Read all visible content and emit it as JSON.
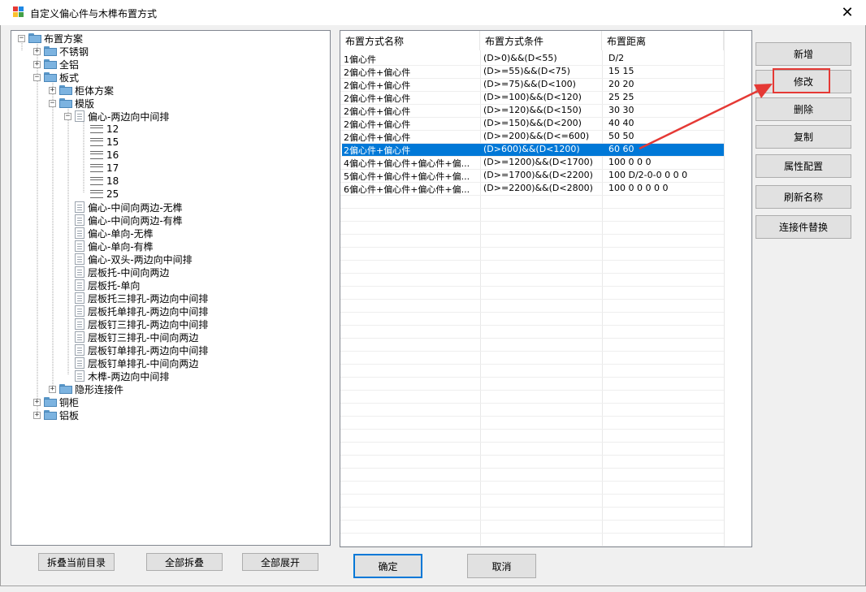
{
  "window": {
    "title": "自定义偏心件与木榫布置方式",
    "close_glyph": "✕"
  },
  "tree": {
    "nodes": [
      {
        "label": "布置方案",
        "toggle": "−",
        "icon": "folder-icon"
      },
      {
        "label": "不锈钢",
        "toggle": "+",
        "icon": "folder-icon"
      },
      {
        "label": "全铝",
        "toggle": "+",
        "icon": "folder-icon"
      },
      {
        "label": "板式",
        "toggle": "−",
        "icon": "folder-icon"
      },
      {
        "label": "柜体方案",
        "toggle": "+",
        "icon": "folder-icon"
      },
      {
        "label": "模版",
        "toggle": "−",
        "icon": "folder-icon"
      },
      {
        "label": "偏心-两边向中间排",
        "toggle": "−",
        "icon": "document-icon"
      },
      {
        "label": "12",
        "icon": "hardware-leaf-icon"
      },
      {
        "label": "15",
        "icon": "hardware-leaf-icon"
      },
      {
        "label": "16",
        "icon": "hardware-leaf-icon"
      },
      {
        "label": "17",
        "icon": "hardware-leaf-icon"
      },
      {
        "label": "18",
        "icon": "hardware-leaf-icon"
      },
      {
        "label": "25",
        "icon": "hardware-leaf-icon"
      },
      {
        "label": "偏心-中间向两边-无榫",
        "icon": "document-icon"
      },
      {
        "label": "偏心-中间向两边-有榫",
        "icon": "document-icon"
      },
      {
        "label": "偏心-单向-无榫",
        "icon": "document-icon"
      },
      {
        "label": "偏心-单向-有榫",
        "icon": "document-icon"
      },
      {
        "label": "偏心-双头-两边向中间排",
        "icon": "document-icon"
      },
      {
        "label": "层板托-中间向两边",
        "icon": "document-icon"
      },
      {
        "label": "层板托-单向",
        "icon": "document-icon"
      },
      {
        "label": "层板托三排孔-两边向中间排",
        "icon": "document-icon"
      },
      {
        "label": "层板托单排孔-两边向中间排",
        "icon": "document-icon"
      },
      {
        "label": "层板钉三排孔-两边向中间排",
        "icon": "document-icon"
      },
      {
        "label": "层板钉三排孔-中间向两边",
        "icon": "document-icon"
      },
      {
        "label": "层板钉单排孔-两边向中间排",
        "icon": "document-icon"
      },
      {
        "label": "层板钉单排孔-中间向两边",
        "icon": "document-icon"
      },
      {
        "label": "木榫-两边向中间排",
        "icon": "document-icon"
      },
      {
        "label": "隐形连接件",
        "toggle": "+",
        "icon": "folder-icon"
      },
      {
        "label": "铜柜",
        "toggle": "+",
        "icon": "folder-icon"
      },
      {
        "label": "铝板",
        "toggle": "+",
        "icon": "folder-icon"
      }
    ]
  },
  "bottom_buttons": {
    "collapse_current": "拆叠当前目录",
    "collapse_all": "全部拆叠",
    "expand_all": "全部展开",
    "ok": "确定",
    "cancel": "取消"
  },
  "grid": {
    "columns": [
      "布置方式名称",
      "布置方式条件",
      "布置距离"
    ],
    "rows": [
      [
        "1偏心件",
        "(D>0)&&(D<55)",
        "D/2"
      ],
      [
        "2偏心件+偏心件",
        "(D>=55)&&(D<75)",
        "15 15"
      ],
      [
        "2偏心件+偏心件",
        "(D>=75)&&(D<100)",
        "20 20"
      ],
      [
        "2偏心件+偏心件",
        "(D>=100)&&(D<120)",
        "25 25"
      ],
      [
        "2偏心件+偏心件",
        "(D>=120)&&(D<150)",
        "30 30"
      ],
      [
        "2偏心件+偏心件",
        "(D>=150)&&(D<200)",
        "40 40"
      ],
      [
        "2偏心件+偏心件",
        "(D>=200)&&(D<=600)",
        "50 50"
      ],
      [
        "2偏心件+偏心件",
        "(D>600)&&(D<1200)",
        "60 60"
      ],
      [
        "4偏心件+偏心件+偏心件+偏...",
        "(D>=1200)&&(D<1700)",
        "100 0 0 0"
      ],
      [
        "5偏心件+偏心件+偏心件+偏...",
        "(D>=1700)&&(D<2200)",
        "100 D/2-0-0 0 0 0"
      ],
      [
        "6偏心件+偏心件+偏心件+偏...",
        "(D>=2200)&&(D<2800)",
        "100 0 0 0 0 0"
      ]
    ],
    "selected_row_number": 8
  },
  "side_buttons": {
    "add": "新增",
    "modify": "修改",
    "delete": "删除",
    "copy": "复制",
    "properties": "属性配置",
    "refresh_name": "刷新名称",
    "replace_connector": "连接件替换"
  },
  "colors": {
    "selection": "#0078d7",
    "annotation": "#e53935"
  }
}
